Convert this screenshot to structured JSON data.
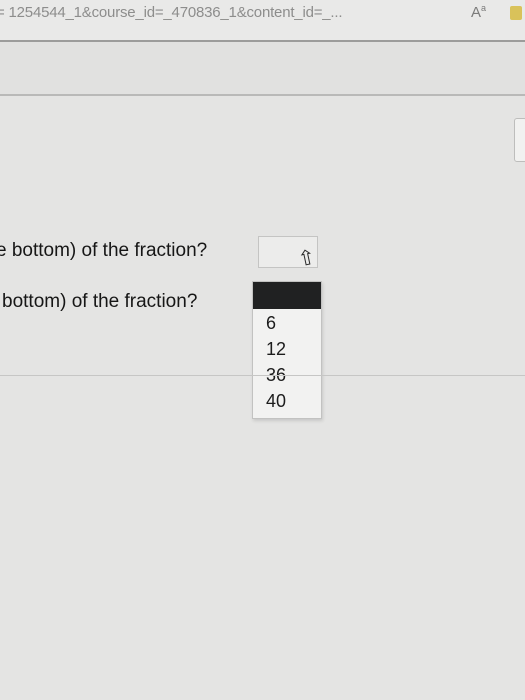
{
  "browser": {
    "address_text": "= 1254544_1&course_id=_470836_1&content_id=_...",
    "reader_icon": "A",
    "reader_icon_sup": "a"
  },
  "questions": [
    {
      "text": "e bottom) of the fraction?",
      "select_value": ""
    },
    {
      "text": "bottom) of the fraction?"
    }
  ],
  "dropdown": {
    "options": [
      "6",
      "12",
      "36",
      "40"
    ],
    "highlighted_index": -1
  },
  "cursor_icon": "pointer-cursor-icon",
  "colors": {
    "highlight": "#202122"
  }
}
